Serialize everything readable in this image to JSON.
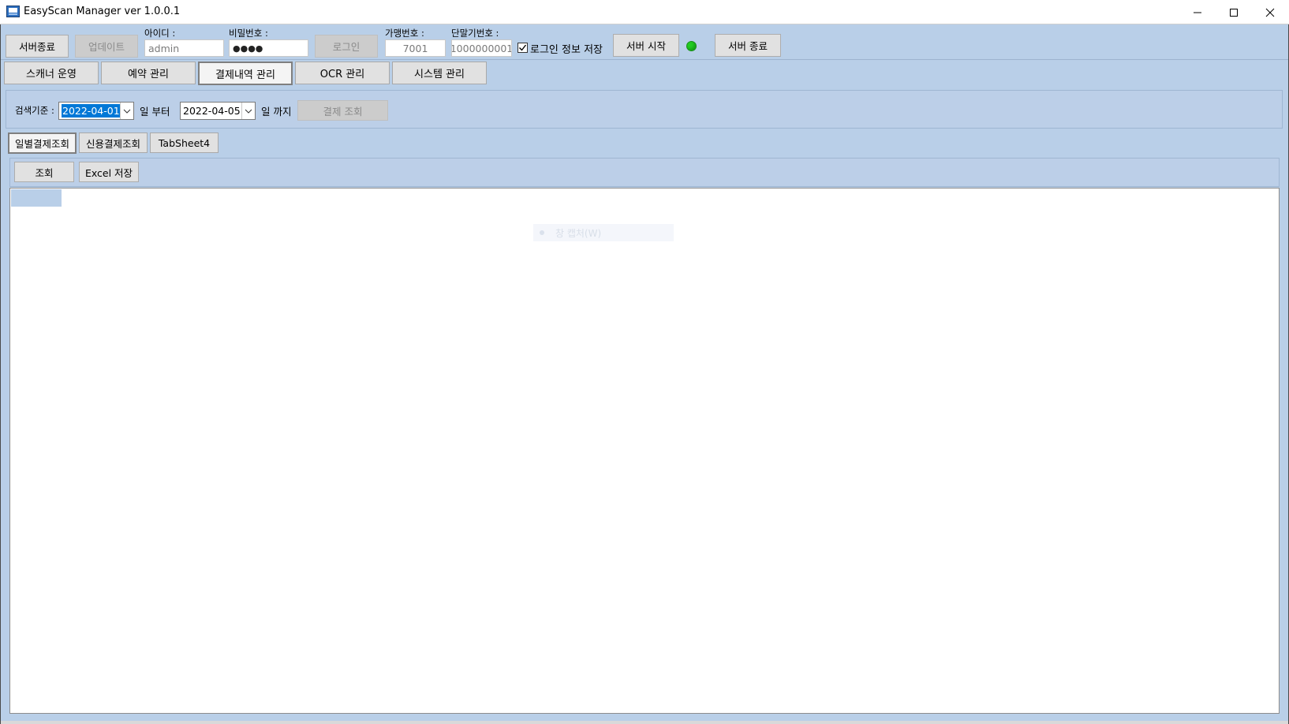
{
  "window": {
    "title": "EasyScan Manager ver 1.0.0.1",
    "minimize_icon": "minimize-icon",
    "maximize_icon": "maximize-icon",
    "close_icon": "close-icon"
  },
  "toolbar": {
    "server_quit_label": "서버종료",
    "update_label": "업데이트",
    "id_label": "아이디 :",
    "id_value": "admin",
    "password_label": "비밀번호 :",
    "password_value": "●●●●",
    "login_label": "로그인",
    "merchant_label": "가맹번호 :",
    "merchant_value": "7001",
    "terminal_label": "단말기번호 :",
    "terminal_value": "1000000001",
    "save_login_label": "로그인 정보 저장",
    "save_login_checked": true,
    "server_start_label": "서버 시작",
    "server_stop_label": "서버 종료",
    "status_color": "#22cc22"
  },
  "main_tabs": [
    {
      "label": "스캐너 운영",
      "active": false
    },
    {
      "label": "예약 관리",
      "active": false
    },
    {
      "label": "결제내역 관리",
      "active": true
    },
    {
      "label": "OCR 관리",
      "active": false
    },
    {
      "label": "시스템 관리",
      "active": false
    }
  ],
  "search": {
    "criteria_label": "검색기준 :",
    "from_date": "2022-04-01",
    "from_suffix": "일 부터",
    "to_date": "2022-04-05",
    "to_suffix": "일 까지",
    "query_button": "결제 조회"
  },
  "sub_tabs": [
    {
      "label": "일별결제조회",
      "active": true
    },
    {
      "label": "신용결제조회",
      "active": false
    },
    {
      "label": "TabSheet4",
      "active": false
    }
  ],
  "actions": {
    "query_label": "조회",
    "excel_label": "Excel 저장"
  },
  "ghost_menu_text": "창 캡처(W)",
  "colors": {
    "background": "#b9cfe8",
    "selection": "#0078d7",
    "status_led": "#22cc22"
  }
}
